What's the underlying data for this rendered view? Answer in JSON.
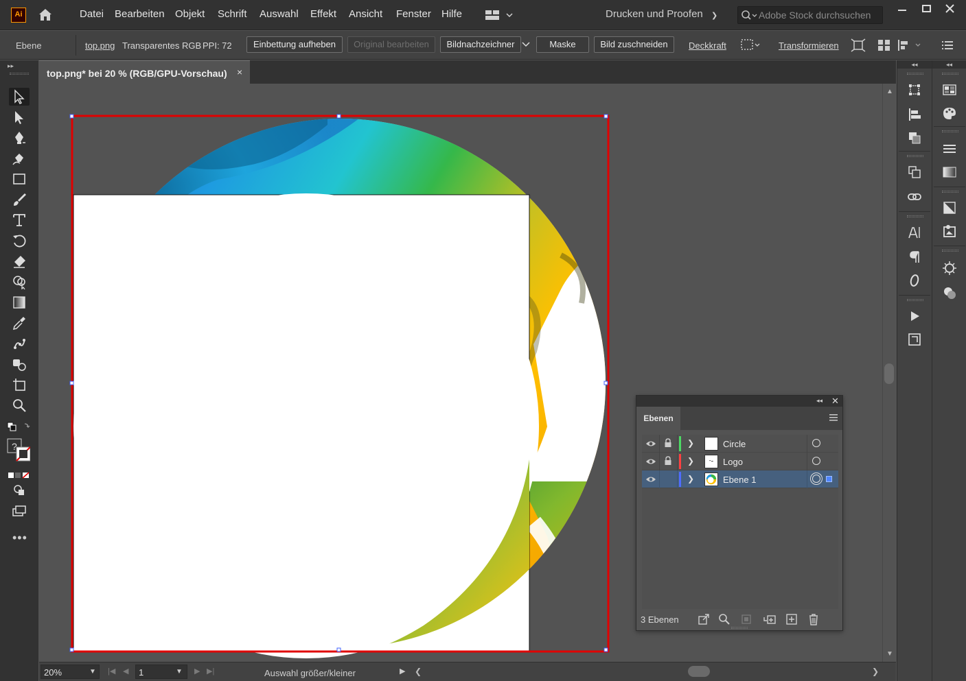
{
  "app": {
    "logo": "Ai",
    "menu": [
      "Datei",
      "Bearbeiten",
      "Objekt",
      "Schrift",
      "Auswahl",
      "Effekt",
      "Ansicht",
      "Fenster",
      "Hilfe"
    ],
    "workspace": "Drucken und Proofen",
    "search_placeholder": "Adobe Stock durchsuchen",
    "accent": "#ff9a00"
  },
  "control_bar": {
    "object_type": "Ebene",
    "file_link": "top.png",
    "color_mode": "Transparentes RGB",
    "ppi": "PPI: 72",
    "buttons": {
      "unembed": "Einbettung aufheben",
      "edit_original": "Original bearbeiten",
      "image_trace": "Bildnachzeichner",
      "mask": "Maske",
      "crop": "Bild zuschneiden",
      "opacity": "Deckkraft",
      "transform": "Transformieren"
    }
  },
  "document_tab": {
    "title": "top.png* bei 20 % (RGB/GPU-Vorschau)",
    "close": "×"
  },
  "status_bar": {
    "zoom": "20%",
    "page": "1",
    "status": "Auswahl größer/kleiner"
  },
  "layers_panel": {
    "title": "Ebenen",
    "count": "3 Ebenen",
    "layers": [
      {
        "name": "Circle",
        "color": "#4cd964",
        "thumb": "blank"
      },
      {
        "name": "Logo",
        "color": "#ff4040",
        "thumb": "logo"
      },
      {
        "name": "Ebene 1",
        "color": "#4f6dff",
        "thumb": "image",
        "selected": true
      }
    ]
  },
  "colors": {
    "selection_red": "#e00000",
    "bounding_blue": "#4060ff",
    "ink_blue": "#1e9be0",
    "ink_green": "#35b84a",
    "ink_yellow": "#ffc000",
    "ink_indigo": "#2a3aa0"
  },
  "icons": {
    "left_tools": [
      "selection-tool-icon",
      "direct-selection-tool-icon",
      "pen-tool-icon",
      "curvature-tool-icon",
      "rectangle-tool-icon",
      "paintbrush-tool-icon",
      "type-tool-icon",
      "rotate-tool-icon",
      "eraser-tool-icon",
      "shape-builder-tool-icon",
      "gradient-tool-icon",
      "eyedropper-tool-icon",
      "puppet-warp-tool-icon",
      "symbol-sprayer-tool-icon",
      "artboard-tool-icon",
      "zoom-tool-icon"
    ],
    "right_dock_1": [
      "transform-panel-icon",
      "align-panel-icon",
      "pathfinder-panel-icon",
      "artboards-panel-icon",
      "links-panel-icon",
      "character-panel-icon",
      "paragraph-panel-icon",
      "opentype-panel-icon",
      "actions-panel-icon",
      "asset-export-panel-icon"
    ],
    "right_dock_2": [
      "swatches-panel-icon",
      "color-guide-panel-icon",
      "stroke-panel-icon",
      "gradient-panel-icon",
      "transparency-panel-icon",
      "image-trace-panel-icon",
      "brushes-panel-icon",
      "appearance-panel-icon"
    ]
  }
}
